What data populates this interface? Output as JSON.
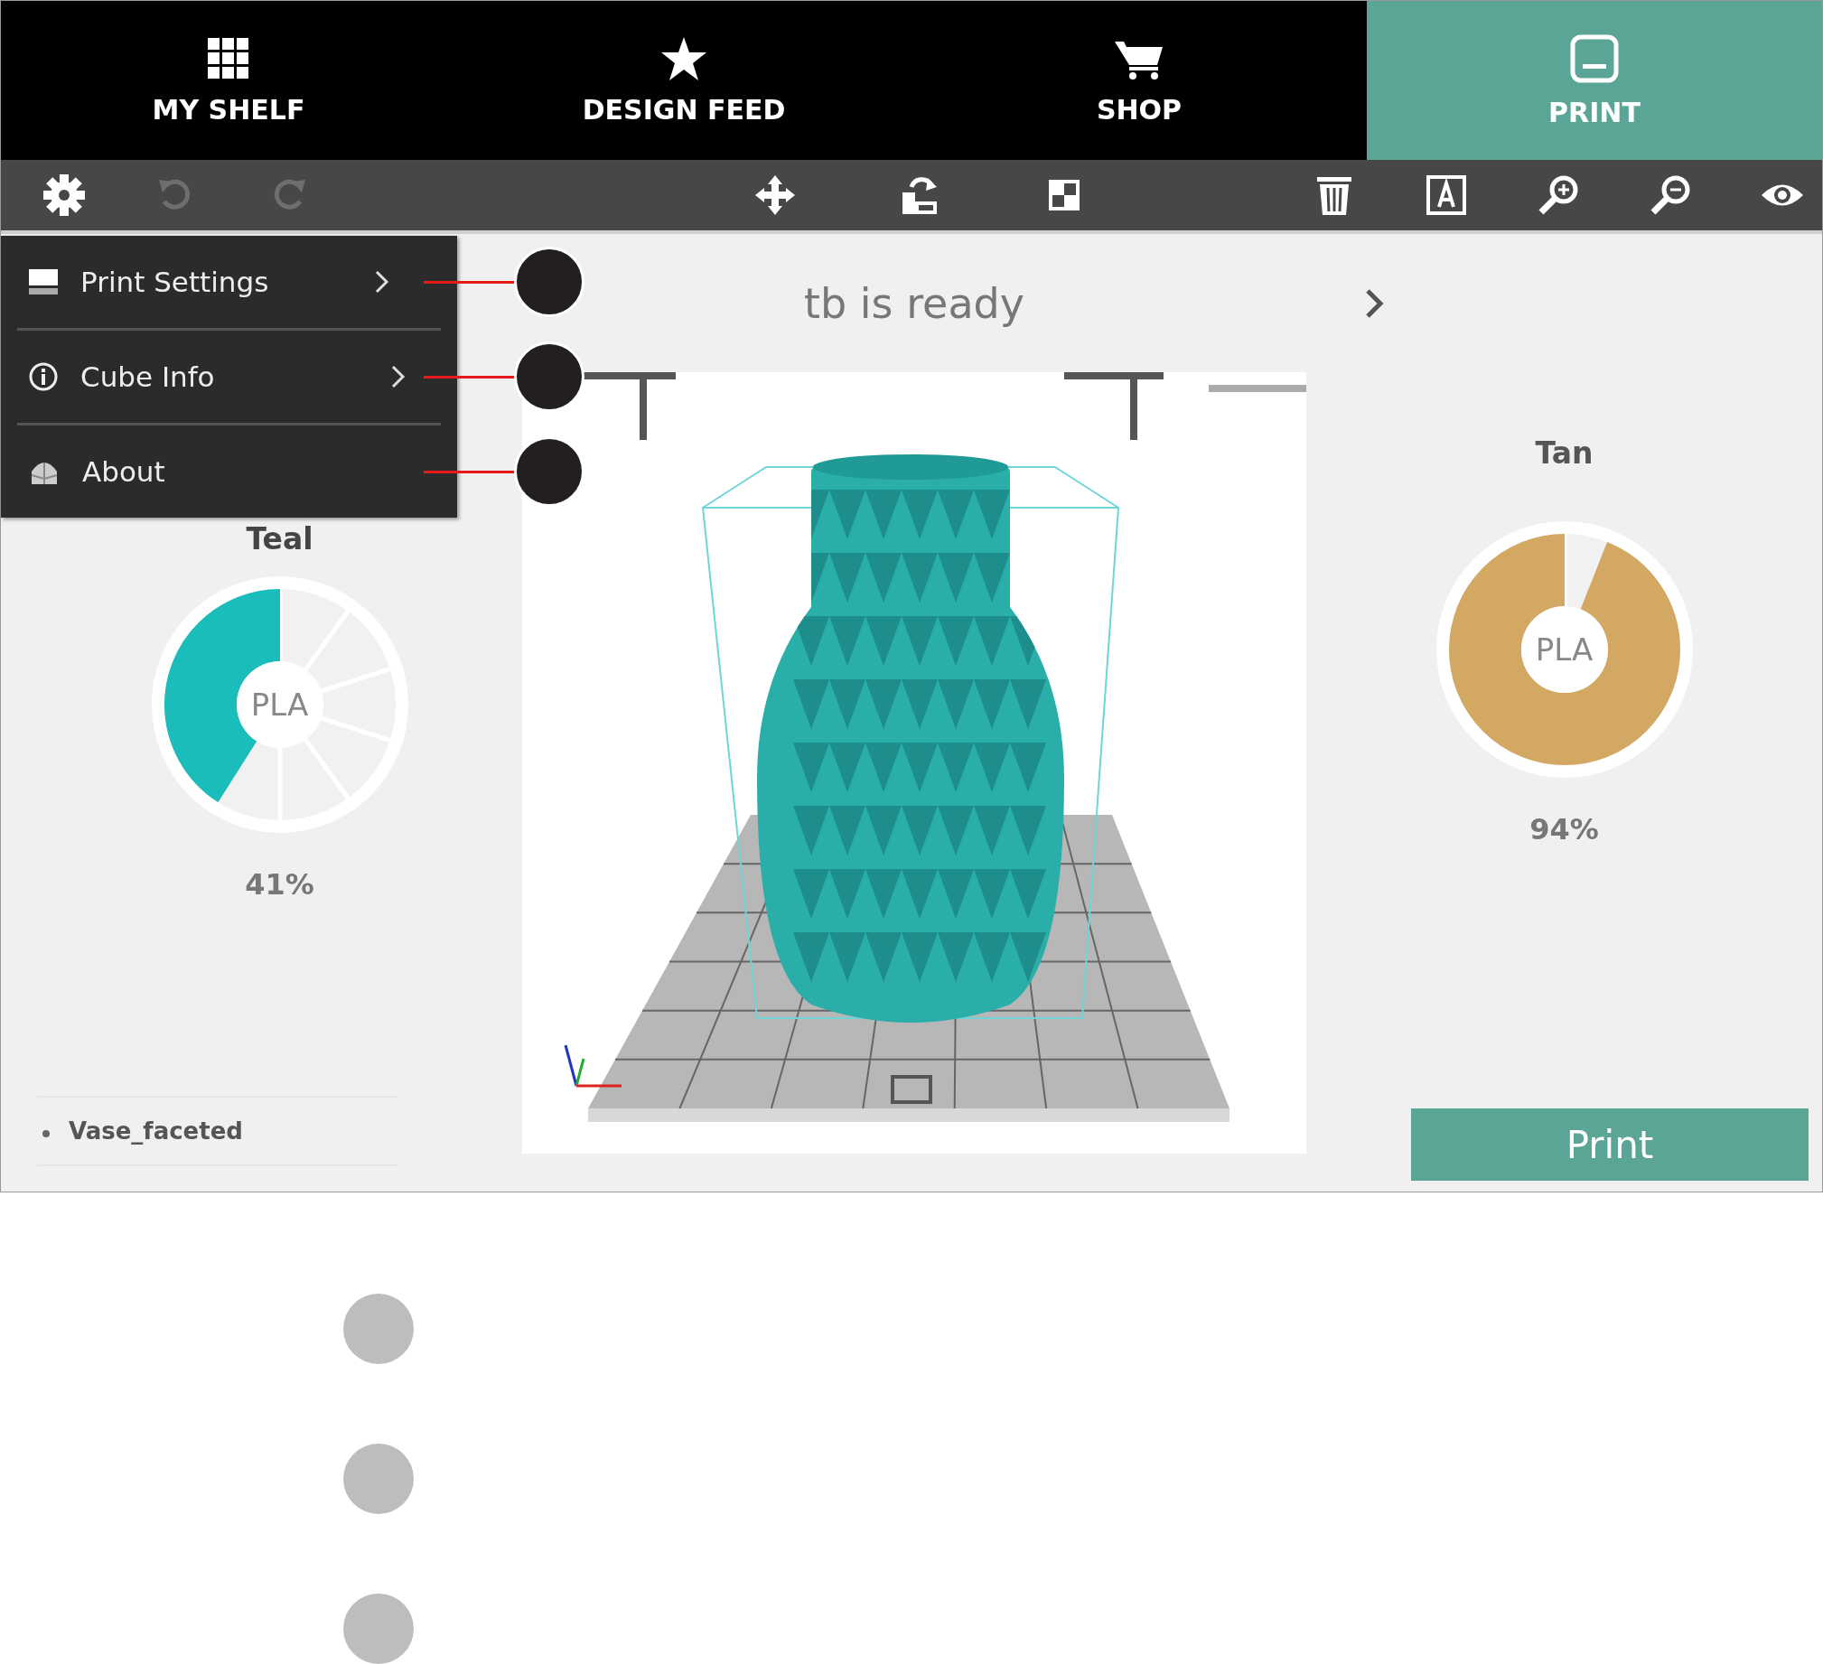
{
  "nav_tabs": [
    {
      "kind": "grid",
      "label": "MY SHELF",
      "selected": false
    },
    {
      "kind": "star",
      "label": "DESIGN FEED",
      "selected": false
    },
    {
      "kind": "cart",
      "label": "SHOP",
      "selected": false
    },
    {
      "kind": "print",
      "label": "PRINT",
      "selected": true
    }
  ],
  "toolbar": [
    {
      "kind": "settings",
      "disabled": false
    },
    {
      "kind": "undo",
      "disabled": true
    },
    {
      "kind": "redo",
      "disabled": true
    },
    {
      "kind": "move",
      "disabled": false
    },
    {
      "kind": "lift",
      "disabled": false
    },
    {
      "kind": "scale",
      "disabled": false
    },
    {
      "kind": "delete",
      "disabled": false
    },
    {
      "kind": "text",
      "disabled": false
    },
    {
      "kind": "zoom-in",
      "disabled": false
    },
    {
      "kind": "zoom-out",
      "disabled": false
    },
    {
      "kind": "view",
      "disabled": false
    }
  ],
  "settings_menu": [
    {
      "kind": "print-settings",
      "label": "Print Settings",
      "has_submenu": true,
      "callout": true
    },
    {
      "kind": "info",
      "label": "Cube Info",
      "has_submenu": true,
      "callout": true
    },
    {
      "kind": "about",
      "label": "About",
      "has_submenu": false,
      "callout": true
    }
  ],
  "status": {
    "title": "tb is ready"
  },
  "cartridges": [
    {
      "name": "Teal",
      "material": "PLA",
      "level": 0.41,
      "reading": "41%",
      "color": "#1bbdbb"
    },
    {
      "name": "Tan",
      "material": "PLA",
      "level": 0.94,
      "reading": "94%",
      "color": "#d3a863"
    }
  ],
  "models": [
    {
      "name": "Vase_faceted"
    }
  ],
  "print_button": {
    "label": "Print"
  }
}
